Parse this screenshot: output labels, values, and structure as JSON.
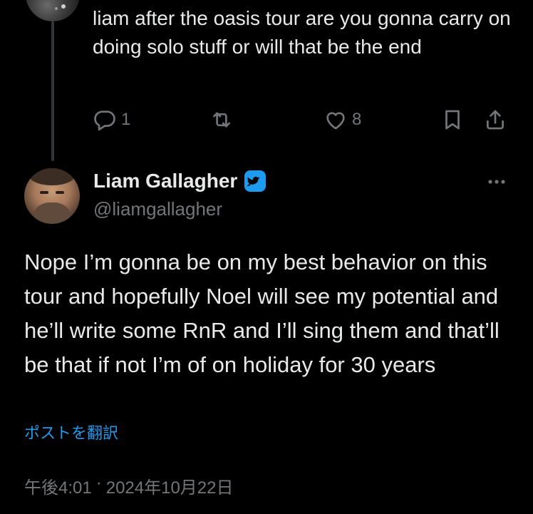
{
  "parent_tweet": {
    "text": "liam after the oasis tour are you gonna carry on doing solo stuff or will that be the end",
    "actions": {
      "reply_count": "1",
      "repost_count": "",
      "like_count": "8"
    }
  },
  "tweet": {
    "display_name": "Liam Gallagher",
    "handle": "@liamgallagher",
    "text": "Nope I’m gonna be on my best behavior on this tour and hopefully Noel will see my potential and he’ll write some RnR and I’ll sing them and that’ll be that if not I’m of on holiday for 30 years",
    "translate_label": "ポストを翻訳",
    "time": "午後4:01",
    "separator": "·",
    "date": "2024年10月22日"
  },
  "icons": {
    "reply": "reply-icon",
    "repost": "repost-icon",
    "like": "heart-icon",
    "bookmark": "bookmark-icon",
    "share": "share-icon",
    "badge": "verified-badge-icon",
    "more": "more-icon"
  },
  "colors": {
    "background": "#000000",
    "text": "#e7e9ea",
    "secondary_text": "#71767b",
    "accent": "#1d9bf0",
    "thread_line": "#333639"
  }
}
